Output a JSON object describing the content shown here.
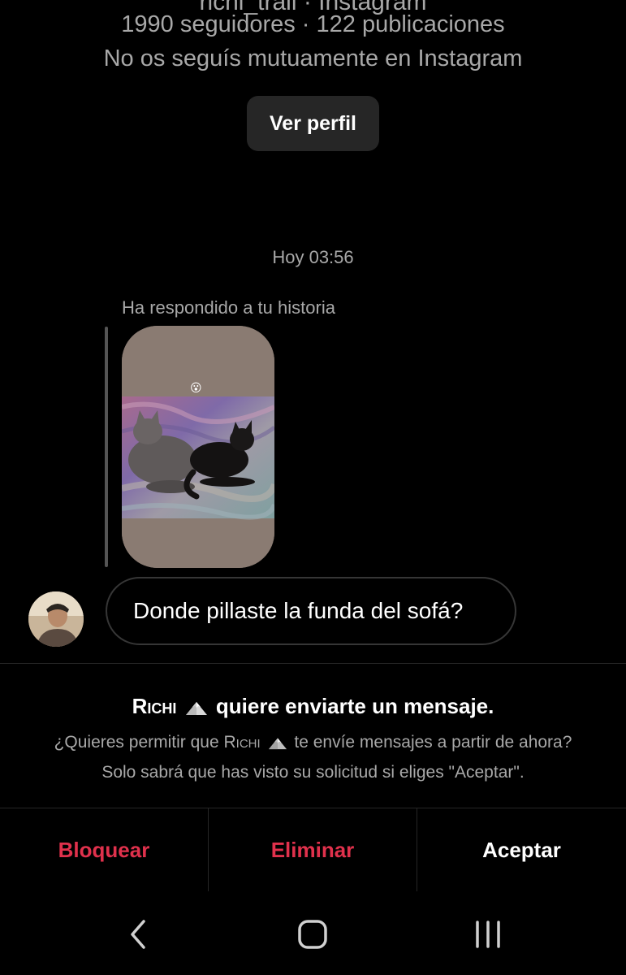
{
  "header": {
    "cut_title": "richi_trail · Instagram",
    "stats": "1990 seguidores · 122 publicaciones",
    "mutual": "No os seguís mutuamente en Instagram",
    "view_profile_label": "Ver perfil"
  },
  "thread": {
    "timestamp": "Hoy 03:56",
    "reply_note": "Ha respondido a tu historia",
    "story_emoji": "😮",
    "message": "Donde pillaste la funda del sofá?"
  },
  "request": {
    "name": "Richi",
    "title_suffix": "quiere enviarte un mensaje.",
    "desc_prefix": "¿Quieres permitir que",
    "desc_suffix": "te envíe mensajes a partir de ahora?",
    "desc_line2": "Solo sabrá que has visto su solicitud si eliges \"Aceptar\"."
  },
  "actions": {
    "block": "Bloquear",
    "delete": "Eliminar",
    "accept": "Aceptar"
  },
  "colors": {
    "background": "#000000",
    "secondary_text": "#a8a8a8",
    "destructive": "#e0314c",
    "button_bg": "#262626"
  },
  "icons": {
    "nav_back": "chevron-left-icon",
    "nav_home": "rounded-square-icon",
    "nav_recents": "three-bars-icon",
    "name_emoji": "mountain-icon"
  }
}
